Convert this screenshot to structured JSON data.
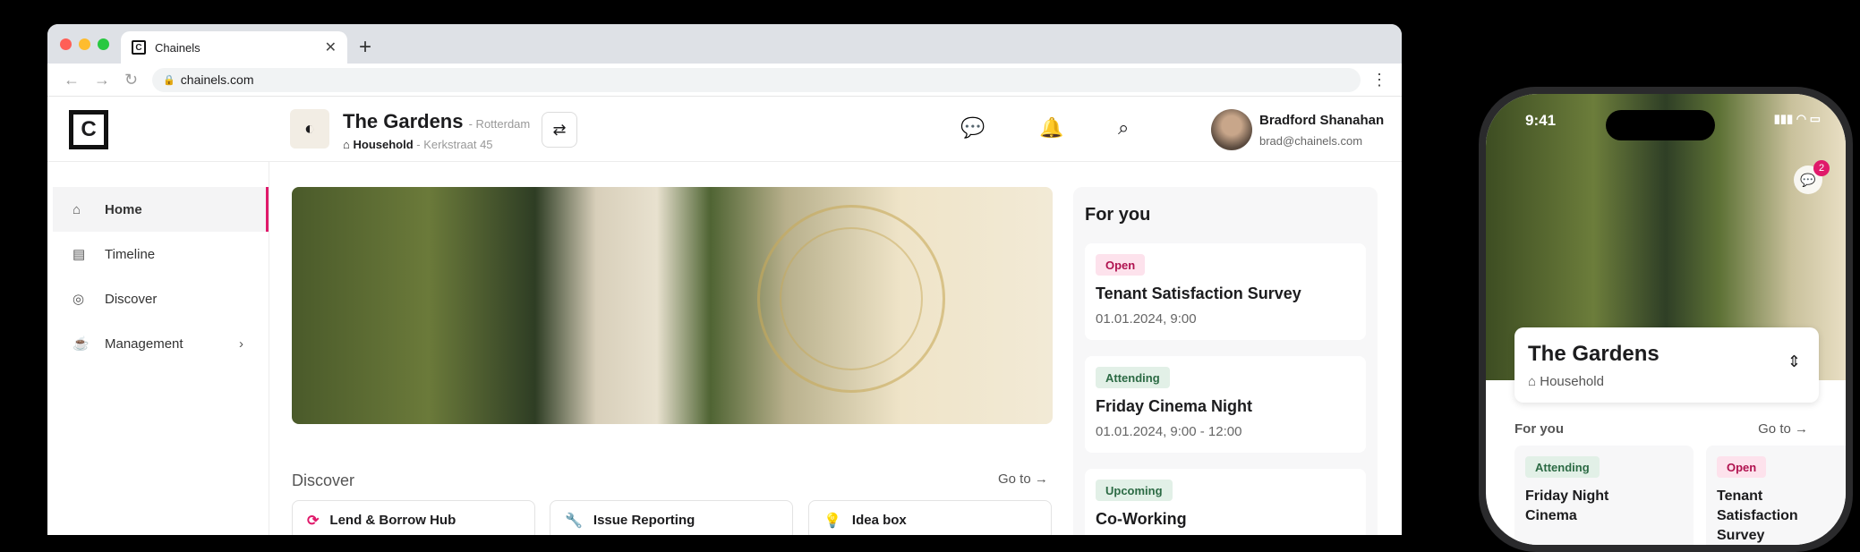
{
  "browser": {
    "tab_title": "Chainels",
    "tab_icon": "chainels-favicon",
    "url": "chainels.com"
  },
  "header": {
    "community_name": "The Gardens",
    "community_city": "- Rotterdam",
    "community_type": "Household",
    "community_address": "- Kerkstraat 45",
    "user_name": "Bradford Shanahan",
    "user_email": "brad@chainels.com",
    "icons": [
      "chat-icon",
      "bell-icon",
      "search-icon",
      "switch-icon"
    ]
  },
  "sidebar": {
    "items": [
      {
        "label": "Home",
        "icon": "home-icon",
        "active": true
      },
      {
        "label": "Timeline",
        "icon": "timeline-icon"
      },
      {
        "label": "Discover",
        "icon": "discover-icon"
      },
      {
        "label": "Management",
        "icon": "management-icon",
        "chevron": true
      }
    ]
  },
  "discover": {
    "title": "Discover",
    "goto": "Go to",
    "tiles": [
      {
        "label": "Lend & Borrow Hub",
        "icon": "refresh-icon"
      },
      {
        "label": "Issue Reporting",
        "icon": "wrench-icon"
      },
      {
        "label": "Idea box",
        "icon": "lightbulb-icon"
      }
    ]
  },
  "for_you": {
    "title": "For you",
    "cards": [
      {
        "badge": "Open",
        "title": "Tenant Satisfaction Survey",
        "date": "01.01.2024, 9:00"
      },
      {
        "badge": "Attending",
        "title": "Friday Cinema Night",
        "date": "01.01.2024, 9:00 - 12:00"
      },
      {
        "badge": "Upcoming",
        "title": "Co-Working",
        "date": ""
      }
    ]
  },
  "phone": {
    "time": "9:41",
    "chat_count": "2",
    "community_name": "The Gardens",
    "community_type": "Household",
    "for_you": "For you",
    "goto": "Go to",
    "tiles": [
      {
        "badge": "Attending",
        "title": "Friday Night Cinema"
      },
      {
        "badge": "Open",
        "title": "Tenant Satisfaction Survey"
      }
    ]
  },
  "colors": {
    "accent": "#e0196a",
    "open_badge_bg": "#fde2ec",
    "attending_badge_bg": "#e2f0e7"
  }
}
